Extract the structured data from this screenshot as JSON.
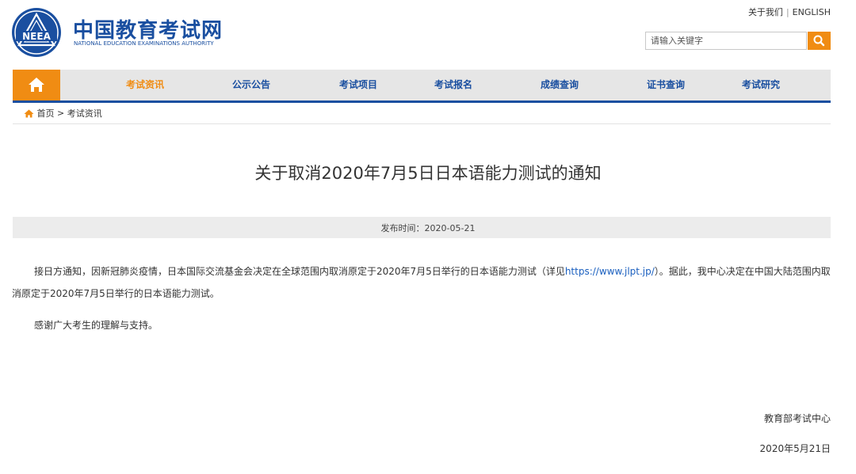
{
  "header": {
    "logo_cn": "中国教育考试网",
    "logo_en": "NATIONAL EDUCATION EXAMINATIONS AUTHORITY",
    "emblem_text": "NEEA",
    "top_links": [
      "关于我们",
      "ENGLISH"
    ],
    "top_sep": "|",
    "search_placeholder": "请输入关键字"
  },
  "nav": {
    "items": [
      "考试资讯",
      "公示公告",
      "考试项目",
      "考试报名",
      "成绩查询",
      "证书查询",
      "考试研究"
    ],
    "active": "考试资讯"
  },
  "breadcrumb": {
    "home": "首页",
    "sep": ">",
    "current": "考试资讯"
  },
  "article": {
    "title": "关于取消2020年7月5日日本语能力测试的通知",
    "publish_label": "发布时间：2020-05-21",
    "p1_before": "接日方通知，因新冠肺炎疫情，日本国际交流基金会决定在全球范围内取消原定于2020年7月5日举行的日本语能力测试（详见",
    "p1_link": "https://www.jlpt.jp/",
    "p1_after": "）。据此，我中心决定在中国大陆范围内取消原定于2020年7月5日举行的日本语能力测试。",
    "p2": "感谢广大考生的理解与支持。",
    "signature": "教育部考试中心",
    "date": "2020年5月21日"
  },
  "colors": {
    "brand_blue": "#1a4fa0",
    "accent_orange": "#f08c13",
    "link_blue": "#1a5fbf"
  },
  "icons": [
    "neea-emblem-icon",
    "search-icon",
    "home-icon",
    "breadcrumb-home-icon"
  ]
}
